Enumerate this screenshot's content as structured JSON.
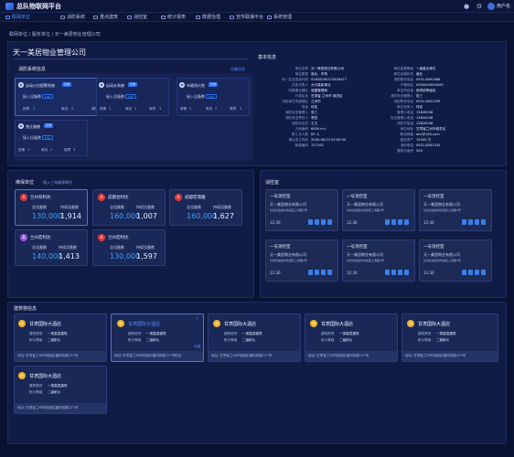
{
  "app": {
    "title": "总队物联网平台",
    "username": "用户名"
  },
  "nav": [
    {
      "label": "联网单位"
    },
    {
      "label": "消防系统"
    },
    {
      "label": "重点建筑"
    },
    {
      "label": "消控室"
    },
    {
      "label": "统计报表"
    },
    {
      "label": "数据治理"
    },
    {
      "label": "宣传联播平台"
    },
    {
      "label": "系统管理"
    }
  ],
  "breadcrumb": "联网单位 / 服务单位 / 天一美居物业管理公司",
  "company": {
    "name": "天一美居物业管理公司"
  },
  "fire_systems": {
    "title": "消防系统信息",
    "link": "设备信息",
    "items": [
      {
        "name": "自动火灾报警系统",
        "status": "正常",
        "device_label": "接入设备数",
        "device_count": "156",
        "normal_label": "报警",
        "normal_value": "1",
        "fault_label": "离线",
        "fault_value": "2",
        "error_label": "故障",
        "error_value": "3"
      },
      {
        "name": "自动水系统",
        "status": "正常",
        "device_label": "接入设备数",
        "device_count": "156",
        "normal_label": "报警",
        "normal_value": "1",
        "fault_label": "离线",
        "fault_value": "2",
        "error_label": "故障",
        "error_value": "3"
      },
      {
        "name": "市政消火栓",
        "status": "正常",
        "device_label": "接入设备数",
        "device_count": "156",
        "normal_label": "报警",
        "normal_value": "1",
        "fault_label": "离线",
        "fault_value": "2",
        "error_label": "故障",
        "error_value": "3"
      },
      {
        "name": "独立烟感",
        "status": "正常",
        "device_label": "接入设备数",
        "device_count": "156",
        "normal_label": "报警",
        "normal_value": "1",
        "fault_label": "离线",
        "fault_value": "2",
        "error_label": "故障",
        "error_value": "3"
      }
    ]
  },
  "basic_info": {
    "title": "基本信息",
    "left": [
      {
        "label": "单位名称",
        "value": "天一美居物业有限公司"
      },
      {
        "label": "单位类型",
        "value": "商业、市场"
      },
      {
        "label": "统一社会信用代码",
        "value": "91620000123456477"
      },
      {
        "label": "法定代表人",
        "value": "大兴高新事业"
      },
      {
        "label": "所属事业辖区",
        "value": "城建管理局"
      },
      {
        "label": "行政区划",
        "value": "甘肃省 兰州市 城关区"
      },
      {
        "label": "消防单位所属辖区",
        "value": "兰州市"
      },
      {
        "label": "电话",
        "value": "待定"
      },
      {
        "label": "消防安全管理人",
        "value": "张三"
      },
      {
        "label": "消防安全责任人",
        "value": "李四"
      },
      {
        "label": "消防安全员",
        "value": "王五"
      },
      {
        "label": "占地面积",
        "value": "6000 m.t"
      },
      {
        "label": "职工总人数",
        "value": "85 人"
      },
      {
        "label": "单位成立时间",
        "value": "2000-06-23 00:00:00"
      },
      {
        "label": "邮政编码",
        "value": "727100"
      }
    ],
    "right": [
      {
        "label": "单位监管等级",
        "value": "一级重点单位"
      },
      {
        "label": "单位经营状态",
        "value": "营业"
      },
      {
        "label": "消防联系电话",
        "value": "0931-8391566"
      },
      {
        "label": "户籍地址",
        "value": "0000000000000"
      },
      {
        "label": "单位所在地",
        "value": "低风险等级区"
      },
      {
        "label": "消防安全管理人",
        "value": "张三"
      },
      {
        "label": "消防联系电话",
        "value": "0931-8391599"
      },
      {
        "label": "单位负责人",
        "value": "待定"
      },
      {
        "label": "管理人电话",
        "value": "15820036"
      },
      {
        "label": "安全管理人电话",
        "value": "13620036"
      },
      {
        "label": "消防员电话",
        "value": "13620036"
      },
      {
        "label": "单位地址",
        "value": "甘肃省兰州市城关区"
      },
      {
        "label": "联系邮箱",
        "value": "abc@163.com"
      },
      {
        "label": "固定资产",
        "value": "15000 万"
      },
      {
        "label": "消防电话",
        "value": "0931-8391533"
      },
      {
        "label": "建筑总面积",
        "value": "500"
      }
    ]
  },
  "maintenance": {
    "title": "维保单位",
    "subtitle": "接入三年维保单位",
    "total_label": "总设备数",
    "maint_label": "持续设备数",
    "items": [
      {
        "icon": "A",
        "name": "兰州有利达",
        "total": "130,000",
        "maint": "1,914"
      },
      {
        "icon": "A",
        "name": "成都合利达",
        "total": "160,000",
        "maint": "1,007"
      },
      {
        "icon": "A",
        "name": "成都宏瑞雅",
        "total": "160,000",
        "maint": "1,627"
      },
      {
        "icon": "B",
        "name": "兰州宏利达",
        "total": "140,000",
        "maint": "1,413"
      },
      {
        "icon": "A",
        "name": "兰州宏利达",
        "total": "130,000",
        "maint": "1,597"
      }
    ]
  },
  "control_rooms": {
    "title": "消控室",
    "items": [
      {
        "name": "一号消控室",
        "company": "天一美居物业有限公司",
        "address": "甘肃省金昌市永昌区上海路3号",
        "time": "12:30"
      },
      {
        "name": "一号消控室",
        "company": "天一美居物业有限公司",
        "address": "甘肃省金昌市永昌区上海路3号",
        "time": "12:30"
      },
      {
        "name": "一号消控室",
        "company": "天一美居物业有限公司",
        "address": "甘肃省金昌市永昌区上海路3号",
        "time": "12:30"
      },
      {
        "name": "一号消控室",
        "company": "天一美居物业有限公司",
        "address": "甘肃省金昌市永昌区上海路3号",
        "time": "12:30"
      },
      {
        "name": "一号消控室",
        "company": "天一美居物业有限公司",
        "address": "甘肃省金昌市永昌区上海路3号",
        "time": "12:30"
      },
      {
        "name": "一号消控室",
        "company": "天一美居物业有限公司",
        "address": "甘肃省金昌市永昌区上海路3号",
        "time": "12:30"
      }
    ]
  },
  "buildings": {
    "title": "建筑物信息",
    "type_label": "建筑类别",
    "level_label": "耐火等级",
    "address_label": "地址：",
    "items": [
      {
        "name": "甘肃国际大酒店",
        "type": "一类高层建筑",
        "level": "二级耐火",
        "address": "甘肃省兰州市西固区福利西路127号"
      },
      {
        "name": "甘肃国际大酒店",
        "type": "一类高层建筑",
        "level": "二级耐火",
        "address": "甘肃省兰州市西固区福利西路127号附近",
        "tag": "1",
        "tag2": "详细"
      },
      {
        "name": "甘肃国际大酒店",
        "type": "一类高层建筑",
        "level": "二级耐火",
        "address": "甘肃省兰州市西固区福利西路127号"
      },
      {
        "name": "甘肃国际大酒店",
        "type": "一类高层建筑",
        "level": "二级耐火",
        "address": "甘肃省兰州市西固区福利西路127号"
      },
      {
        "name": "甘肃国际大酒店",
        "type": "一类高层建筑",
        "level": "二级耐火",
        "address": "甘肃省兰州市西固区福利西路127号"
      },
      {
        "name": "甘肃国际大酒店",
        "type": "一类高层建筑",
        "level": "二级耐火",
        "address": "甘肃省兰州市西固区福利西路127号"
      }
    ]
  }
}
